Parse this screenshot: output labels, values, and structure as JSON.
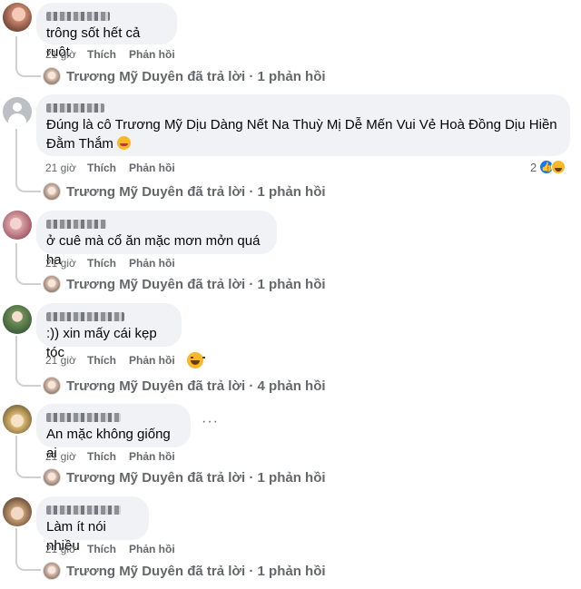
{
  "comments": [
    {
      "text": "trông sốt hết cả ruột",
      "time": "21 giờ",
      "like": "Thích",
      "reply": "Phản hồi",
      "replies": "Trương Mỹ Duyên đã trả lời · 1 phản hồi"
    },
    {
      "text": "Đúng là cô Trương Mỹ Dịu Dàng Nết Na Thuỳ Mị Dễ Mến Vui Vẻ Hoà Đồng Dịu Hiền Đằm Thắm",
      "emoji": "grinning-face-emoji",
      "time": "21 giờ",
      "like": "Thích",
      "reply": "Phản hồi",
      "reaction_count": "2",
      "reactions": [
        "like-reaction-icon",
        "haha-reaction-icon"
      ],
      "replies": "Trương Mỹ Duyên đã trả lời · 1 phản hồi"
    },
    {
      "text": "ở cuê mà cổ ăn mặc mơn mởn quá ha",
      "time": "21 giờ",
      "like": "Thích",
      "reply": "Phản hồi",
      "replies": "Trương Mỹ Duyên đã trả lời · 1 phản hồi"
    },
    {
      "text": ":)) xin mấy cái kẹp tóc",
      "time": "21 giờ",
      "like": "Thích",
      "reply": "Phản hồi",
      "reactions": [
        "haha-reaction-icon"
      ],
      "replies": "Trương Mỹ Duyên đã trả lời · 4 phản hồi"
    },
    {
      "text": "An mặc không giống ai",
      "time": "21 giờ",
      "like": "Thích",
      "reply": "Phản hồi",
      "more": "···",
      "replies": "Trương Mỹ Duyên đã trả lời · 1 phản hồi"
    },
    {
      "text": "Làm ít nói nhiều",
      "time": "21 giờ",
      "like": "Thích",
      "reply": "Phản hồi",
      "replies": "Trương Mỹ Duyên đã trả lời · 1 phản hồi"
    }
  ],
  "colors": {
    "bubble": "#f0f2f5",
    "meta": "#65676b",
    "like_blue": "#1877f2",
    "haha_yellow": "#f7b928"
  }
}
